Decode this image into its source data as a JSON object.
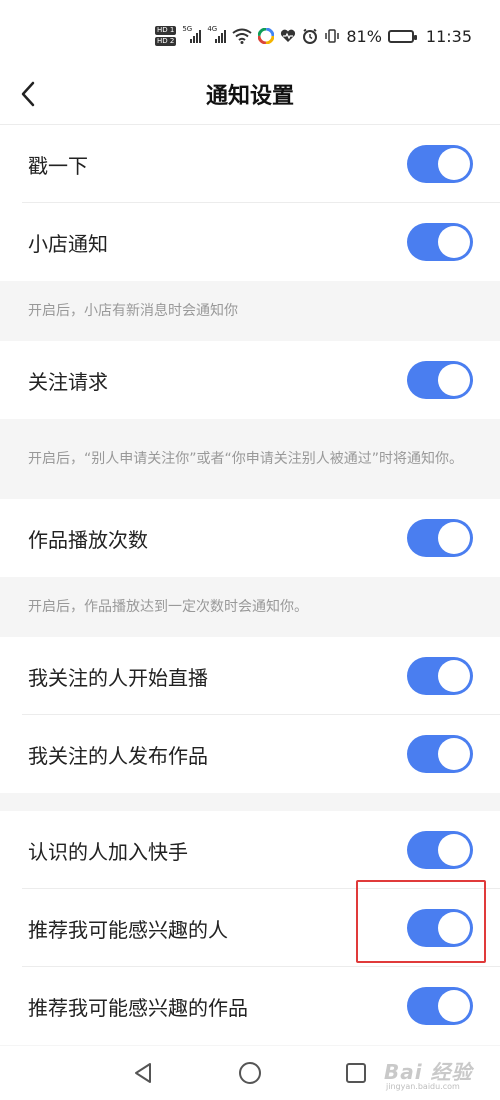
{
  "status_bar": {
    "hd_badges": [
      "HD 1",
      "HD 2"
    ],
    "network_1": "5G",
    "network_2": "4G",
    "wifi_tag": "6",
    "battery_text": "81%",
    "battery_level": 0.81,
    "time": "11:35"
  },
  "header": {
    "title": "通知设置"
  },
  "settings": {
    "item_1": {
      "label": "戳一下",
      "enabled": true
    },
    "item_2": {
      "label": "小店通知",
      "enabled": true,
      "note": "开启后，小店有新消息时会通知你"
    },
    "item_3": {
      "label": "关注请求",
      "enabled": true,
      "note": "开启后，“别人申请关注你”或者“你申请关注别人被通过”时将通知你。"
    },
    "item_4": {
      "label": "作品播放次数",
      "enabled": true,
      "note": "开启后，作品播放达到一定次数时会通知你。"
    },
    "item_5": {
      "label": "我关注的人开始直播",
      "enabled": true
    },
    "item_6": {
      "label": "我关注的人发布作品",
      "enabled": true
    },
    "item_7": {
      "label": "认识的人加入快手",
      "enabled": true
    },
    "item_8": {
      "label": "推荐我可能感兴趣的人",
      "enabled": true
    },
    "item_9": {
      "label": "推荐我可能感兴趣的作品",
      "enabled": true
    }
  },
  "colors": {
    "toggle_on": "#4a7ef0",
    "highlight": "#e03a3a",
    "note_text": "#999999",
    "section_bg": "#f5f5f5"
  },
  "watermark": {
    "main": "Bai 经验",
    "sub": "jingyan.baidu.com"
  },
  "icons": {
    "back": "chevron-left-icon",
    "nav_back": "triangle-back-icon",
    "nav_home": "circle-home-icon",
    "nav_recent": "square-recents-icon"
  }
}
